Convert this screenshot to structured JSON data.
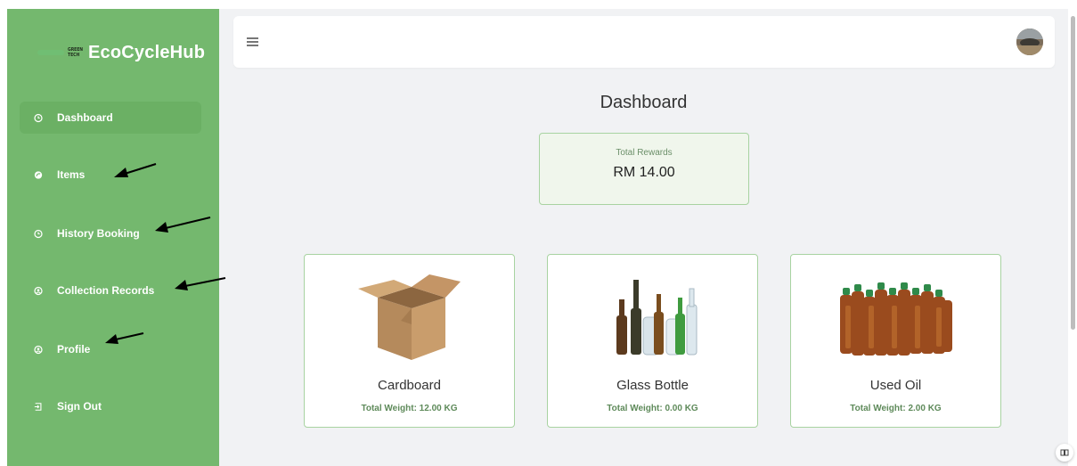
{
  "brand": {
    "logo_mark_line1": "GREEN",
    "logo_mark_line2": "TECH",
    "name": "EcoCycleHub"
  },
  "sidebar": {
    "items": [
      {
        "label": "Dashboard",
        "icon": "clock-icon",
        "active": true
      },
      {
        "label": "Items",
        "icon": "recycle-icon"
      },
      {
        "label": "History Booking",
        "icon": "history-icon"
      },
      {
        "label": "Collection Records",
        "icon": "user-circle-icon"
      },
      {
        "label": "Profile",
        "icon": "user-circle-icon"
      },
      {
        "label": "Sign Out",
        "icon": "sign-out-icon"
      }
    ]
  },
  "header": {
    "menu_icon": "hamburger-icon",
    "avatar": "user-avatar"
  },
  "page": {
    "title": "Dashboard"
  },
  "rewards": {
    "label": "Total Rewards",
    "value": "RM 14.00"
  },
  "cards": [
    {
      "name": "Cardboard",
      "weight": "Total Weight: 12.00 KG",
      "image": "cardboard-box"
    },
    {
      "name": "Glass Bottle",
      "weight": "Total Weight: 0.00 KG",
      "image": "glass-bottles"
    },
    {
      "name": "Used Oil",
      "weight": "Total Weight: 2.00 KG",
      "image": "used-oil-bottles"
    }
  ],
  "colors": {
    "sidebar": "#74b86e",
    "accent_border": "#a8d3a1",
    "main_bg": "#f1f2f4"
  }
}
